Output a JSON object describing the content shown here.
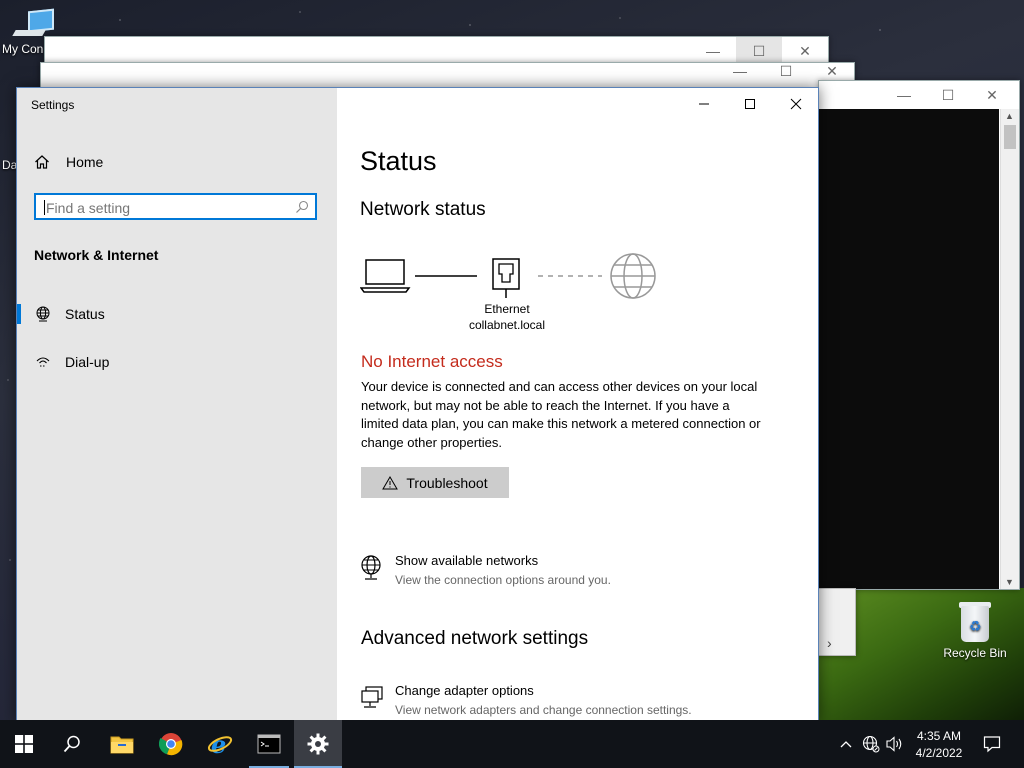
{
  "desktop": {
    "icons": [
      {
        "label": "My Con",
        "icon": "computer-icon"
      },
      {
        "label": "Da"
      },
      {
        "label": "Recycle Bin",
        "icon": "recycle-bin-icon"
      }
    ]
  },
  "settings_window": {
    "title": "Settings",
    "sidebar": {
      "home_label": "Home",
      "search_placeholder": "Find a setting",
      "section_heading": "Network & Internet",
      "items": [
        {
          "label": "Status",
          "icon": "globe-icon",
          "selected": true
        },
        {
          "label": "Dial-up",
          "icon": "dialup-icon",
          "selected": false
        }
      ]
    },
    "main": {
      "page_title": "Status",
      "network_status_heading": "Network status",
      "diagram": {
        "adapter_name": "Ethernet",
        "network_name": "collabnet.local"
      },
      "alert": "No Internet access",
      "description": "Your device is connected and can access other devices on your local network, but may not be able to reach the Internet. If you have a limited data plan, you can make this network a metered connection or change other properties.",
      "troubleshoot_label": "Troubleshoot",
      "show_networks": {
        "title": "Show available networks",
        "subtitle": "View the connection options around you."
      },
      "advanced_heading": "Advanced network settings",
      "adapter_options": {
        "title": "Change adapter options",
        "subtitle": "View network adapters and change connection settings."
      }
    }
  },
  "taskbar": {
    "apps": [
      "start",
      "search",
      "file-explorer",
      "chrome",
      "internet-explorer",
      "command-prompt",
      "settings"
    ],
    "clock": {
      "time": "4:35 AM",
      "date": "4/2/2022"
    }
  },
  "colors": {
    "accent": "#0078d7",
    "alert": "#c42b1c",
    "sidebar_bg": "#e6e6e6",
    "taskbar_bg": "#101318"
  }
}
